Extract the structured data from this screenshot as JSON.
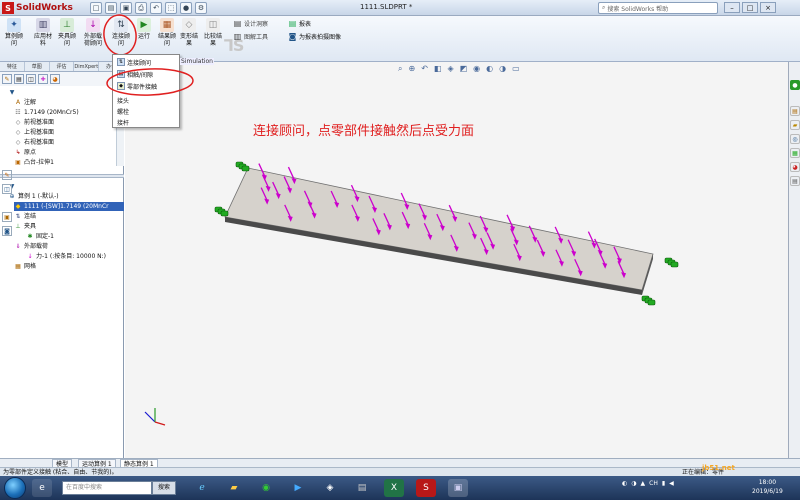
{
  "app": {
    "name": "SolidWorks",
    "doc_title": "1111.SLDPRT *",
    "help_search_placeholder": "搜索 SolidWorks 帮助"
  },
  "commands": [
    {
      "label": "算例顾问",
      "icon": "study-advisor-icon"
    },
    {
      "label": "应用材料",
      "icon": "material-icon"
    },
    {
      "label": "夹具顾问",
      "icon": "fixture-icon"
    },
    {
      "label": "外部载荷顾问",
      "icon": "load-icon"
    },
    {
      "label": "连接顾问",
      "icon": "connection-icon"
    },
    {
      "label": "运行",
      "icon": "run-icon"
    },
    {
      "label": "结果顾问",
      "icon": "result-icon"
    },
    {
      "label": "变形结果",
      "icon": "deformed-icon"
    },
    {
      "label": "比较结果",
      "icon": "compare-icon"
    }
  ],
  "side_commands": [
    "设计洞察",
    "图解工具",
    "报表",
    "为报表拍摄图像"
  ],
  "dropdown": {
    "items": [
      "连接顾问",
      "相触/间隙",
      "零部件接触",
      "接头",
      "螺栓",
      "接杆"
    ],
    "tab_label": "Simulation"
  },
  "panel_tabs": [
    "特征",
    "草图",
    "评估",
    "DimXpert",
    "办公"
  ],
  "feature_tree": [
    {
      "label": "注解",
      "icon": "annotation-icon"
    },
    {
      "label": "1.7149 (20MnCr5)",
      "icon": "material-icon"
    },
    {
      "label": "前视基准面",
      "icon": "plane-icon"
    },
    {
      "label": "上视基准面",
      "icon": "plane-icon"
    },
    {
      "label": "右视基准面",
      "icon": "plane-icon"
    },
    {
      "label": "原点",
      "icon": "origin-icon"
    },
    {
      "label": "凸台-拉伸1",
      "icon": "extrude-icon"
    }
  ],
  "sim_tree": [
    {
      "label": "算例 1 (-默认-)",
      "icon": "study-icon",
      "selected": false
    },
    {
      "label": "1111 (-[SW]1.7149 (20MnCr",
      "icon": "part-icon",
      "selected": true
    },
    {
      "label": "连结",
      "icon": "connection-icon",
      "selected": false
    },
    {
      "label": "夹具",
      "icon": "fixture-icon",
      "selected": false
    },
    {
      "label": "固定-1",
      "icon": "fixture-icon",
      "selected": false
    },
    {
      "label": "外部载荷",
      "icon": "load-icon",
      "selected": false
    },
    {
      "label": "力-1 (:按条目: 10000 N:)",
      "icon": "force-icon",
      "selected": false
    },
    {
      "label": "网格",
      "icon": "mesh-icon",
      "selected": false
    }
  ],
  "annotation": "连接顾问，点零部件接触然后点受力面",
  "doc_tabs": [
    "模型",
    "运动算例 1",
    "静态算例 1"
  ],
  "status_text": "为零部件定义接触 (粘合、自由、节我的)。",
  "status_right": "正在编辑：零件",
  "taskbar": {
    "search_placeholder": "在百度中搜索",
    "search_button": "搜索",
    "clock_time": "18:00",
    "clock_date": "2019/6/19",
    "tray_lang": "CH"
  },
  "watermark": "jb51.net",
  "colors": {
    "arrow": "#cc00cc",
    "fixture": "#22aa22",
    "annotation": "#e02020",
    "highlight": "#e02020"
  }
}
